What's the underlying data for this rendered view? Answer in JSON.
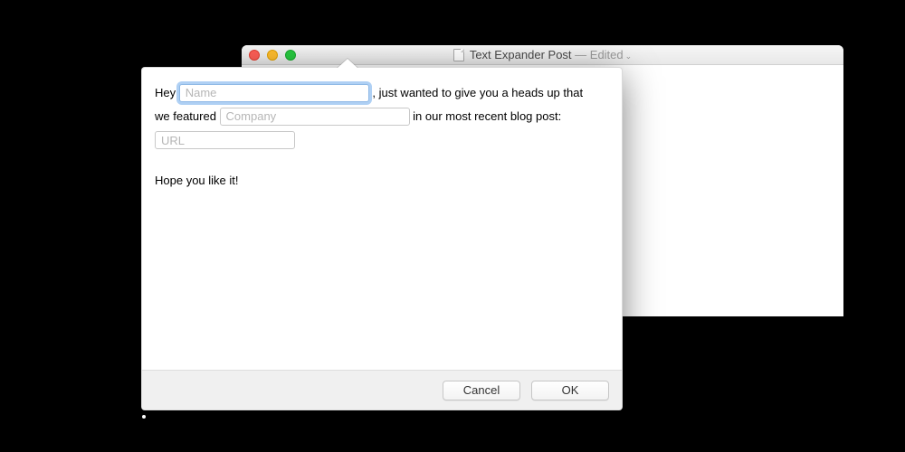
{
  "window": {
    "title": "Text Expander Post",
    "status_suffix": " — Edited"
  },
  "snippet": {
    "line1_pre": "Hey ",
    "line1_post": ", just wanted to give you a heads up that",
    "line2_pre": "we featured ",
    "line2_post": " in our most recent blog post:",
    "closing": "Hope you like it!"
  },
  "placeholders": {
    "name": "Name",
    "company": "Company",
    "url": "URL"
  },
  "buttons": {
    "cancel": "Cancel",
    "ok": "OK"
  }
}
